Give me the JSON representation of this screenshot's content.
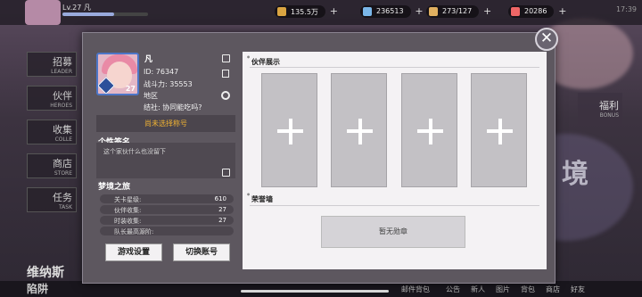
{
  "hud": {
    "level": "Lv.27",
    "player_name": "凡",
    "currency_1": "135.5万",
    "currency_2": "236513",
    "currency_3": "273/127",
    "currency_4": "20286",
    "time": "17:39"
  },
  "background_menu": [
    {
      "cn": "招募",
      "en": "LEADER"
    },
    {
      "cn": "伙伴",
      "en": "HEROES"
    },
    {
      "cn": "收集",
      "en": "COLLE"
    },
    {
      "cn": "商店",
      "en": "STORE"
    },
    {
      "cn": "任务",
      "en": "TASK"
    }
  ],
  "background_right": {
    "bonus_cn": "福利",
    "bonus_en": "BONUS",
    "big": "境"
  },
  "background_bottom": {
    "left": "维纳斯",
    "left2": "陷阱",
    "nav": [
      "邮件背包",
      "公告",
      "新人",
      "图片",
      "背包",
      "商店",
      "好友"
    ]
  },
  "profile": {
    "name": "凡",
    "id_label": "ID:",
    "id_value": "76347",
    "power_label": "战斗力:",
    "power_value": "35553",
    "region_label": "地区",
    "guild_label": "结社:",
    "guild_value": "协同能吃吗?",
    "level_badge": "27",
    "title_status": "尚未选择称号"
  },
  "signature": {
    "title": "个性签名",
    "text": "这个家伙什么也没留下"
  },
  "journey": {
    "title": "梦境之旅",
    "rows": [
      {
        "label": "关卡星级:",
        "value": "610"
      },
      {
        "label": "伙伴收集:",
        "value": "27"
      },
      {
        "label": "时装收集:",
        "value": "27"
      },
      {
        "label": "队长最高源阶:",
        "value": ""
      }
    ]
  },
  "buttons": {
    "game_settings": "游戏设置",
    "switch_account": "切换账号"
  },
  "partner_showcase": {
    "title": "伙伴展示",
    "slots": 4
  },
  "honor_wall": {
    "title": "荣誉墙",
    "empty_text": "暂无勋章"
  },
  "colors": {
    "accent_title": "#f0b233",
    "panel": "#5d575f",
    "content_bg": "#f4f2f4"
  }
}
